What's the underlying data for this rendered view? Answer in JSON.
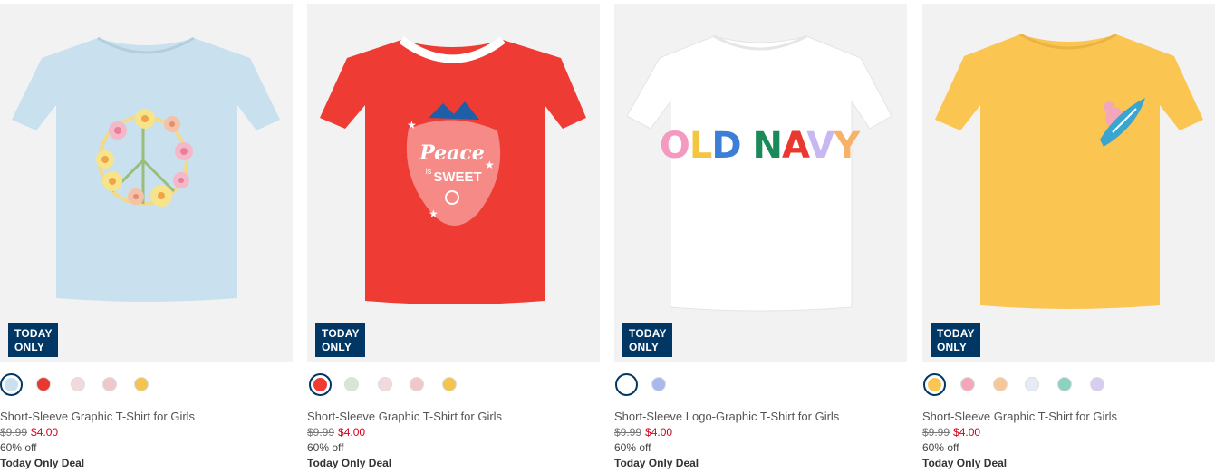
{
  "products": [
    {
      "title": "Short-Sleeve Graphic T-Shirt for Girls",
      "badge_line1": "TODAY",
      "badge_line2": "ONLY",
      "was_price": "$9.99",
      "now_price": "$4.00",
      "discount": "60% off",
      "deal_label": "Today Only Deal",
      "shirt_color": "#c9e0ee",
      "graphic": "flower-peace-sign",
      "swatches": [
        "#c9e0ee",
        "#e8382f",
        "#f2d9dc",
        "#f0c8cc",
        "#f3c44f"
      ]
    },
    {
      "title": "Short-Sleeve Graphic T-Shirt for Girls",
      "badge_line1": "TODAY",
      "badge_line2": "ONLY",
      "was_price": "$9.99",
      "now_price": "$4.00",
      "discount": "60% off",
      "deal_label": "Today Only Deal",
      "shirt_color": "#ee3b33",
      "graphic": "strawberry",
      "graphic_text1": "Peace",
      "graphic_text2": "is",
      "graphic_text3": "SWEET",
      "swatches": [
        "#ee3b33",
        "#d8e6d6",
        "#f2d9dc",
        "#f0c8cc",
        "#f3c44f"
      ]
    },
    {
      "title": "Short-Sleeve Logo-Graphic T-Shirt for Girls",
      "badge_line1": "TODAY",
      "badge_line2": "ONLY",
      "was_price": "$9.99",
      "now_price": "$4.00",
      "discount": "60% off",
      "deal_label": "Today Only Deal",
      "shirt_color": "#ffffff",
      "graphic": "logo-text",
      "logo_letters": [
        "O",
        "L",
        "D",
        " ",
        "N",
        "A",
        "V",
        "Y"
      ],
      "swatches": [
        "#ffffff",
        "#aab8ee"
      ]
    },
    {
      "title": "Short-Sleeve Graphic T-Shirt for Girls",
      "badge_line1": "TODAY",
      "badge_line2": "ONLY",
      "was_price": "$9.99",
      "now_price": "$4.00",
      "discount": "60% off",
      "deal_label": "Today Only Deal",
      "shirt_color": "#fbc552",
      "graphic": "surfboard-character",
      "swatches": [
        "#fbc552",
        "#f4a7b8",
        "#f6c79a",
        "#e6ecf5",
        "#8ed0c2",
        "#d7cdf0"
      ]
    }
  ]
}
